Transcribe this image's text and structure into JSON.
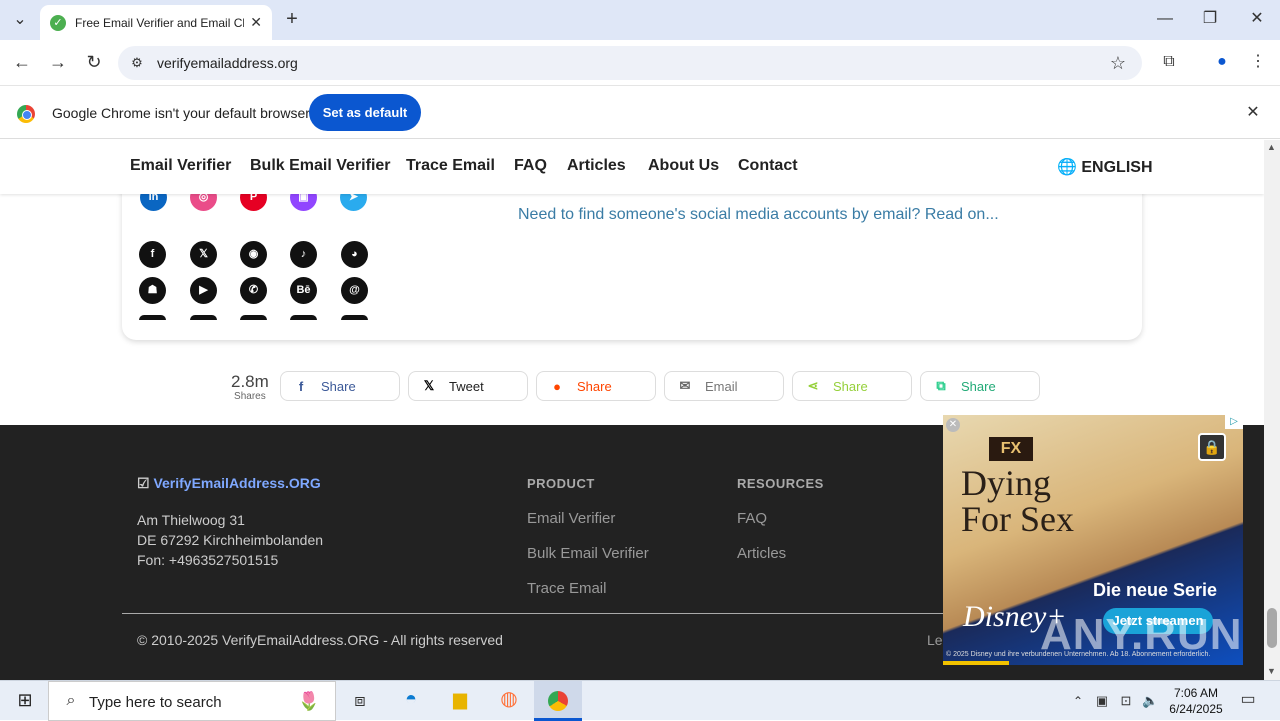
{
  "browser": {
    "tab_title": "Free Email Verifier and Email Ch",
    "url": "verifyemailaddress.org",
    "infobar_text": "Google Chrome isn't your default browser",
    "set_default_label": "Set as default"
  },
  "nav": {
    "items": [
      "Email Verifier",
      "Bulk Email Verifier",
      "Trace Email",
      "FAQ",
      "Articles",
      "About Us",
      "Contact"
    ],
    "language": "ENGLISH"
  },
  "card": {
    "read_on_text": "Need to find someone's social media accounts by email? Read on...",
    "top_row_icons": [
      "linkedin-icon",
      "dribbble-icon",
      "pinterest-icon",
      "twitch-icon",
      "telegram-icon"
    ],
    "row1_icons": [
      "facebook-icon",
      "x-icon",
      "instagram-icon",
      "tiktok-icon",
      "discord-icon"
    ],
    "row2_icons": [
      "snapchat-icon",
      "youtube-icon",
      "whatsapp-icon",
      "behance-icon",
      "threads-icon"
    ]
  },
  "share": {
    "count": "2.8m",
    "count_label": "Shares",
    "buttons": [
      {
        "label": "Share",
        "icon": "facebook-icon",
        "color": "#3b5998"
      },
      {
        "label": "Tweet",
        "icon": "x-icon",
        "color": "#000000"
      },
      {
        "label": "Share",
        "icon": "reddit-icon",
        "color": "#ff4500"
      },
      {
        "label": "Email",
        "icon": "email-icon",
        "color": "#666666"
      },
      {
        "label": "Share",
        "icon": "share-icon",
        "color": "#95d03a"
      },
      {
        "label": "Share",
        "icon": "copy-icon",
        "color": "#22cc88"
      }
    ]
  },
  "footer": {
    "brand": "VerifyEmailAddress.ORG",
    "address_line1": "Am Thielwoog 31",
    "address_line2": "DE 67292 Kirchheimbolanden",
    "address_line3": "Fon: +4963527501515",
    "product_heading": "PRODUCT",
    "product_links": [
      "Email Verifier",
      "Bulk Email Verifier",
      "Trace Email"
    ],
    "resources_heading": "RESOURCES",
    "resources_links": [
      "FAQ",
      "Articles"
    ],
    "copyright": "© 2010-2025 VerifyEmailAddress.ORG - All rights reserved",
    "legal_fragment": "Le"
  },
  "ad": {
    "network": "FX",
    "title_line1": "Dying",
    "title_line2": "For Sex",
    "headline": "Die neue Serie",
    "cta": "Jetzt streamen",
    "brand": "Disney+",
    "fineprint": "© 2025 Disney und ihre verbundenen Unternehmen. Ab 18. Abonnement erforderlich."
  },
  "taskbar": {
    "search_placeholder": "Type here to search",
    "time": "7:06 AM",
    "date": "6/24/2025"
  },
  "watermark": "ANY.RUN"
}
